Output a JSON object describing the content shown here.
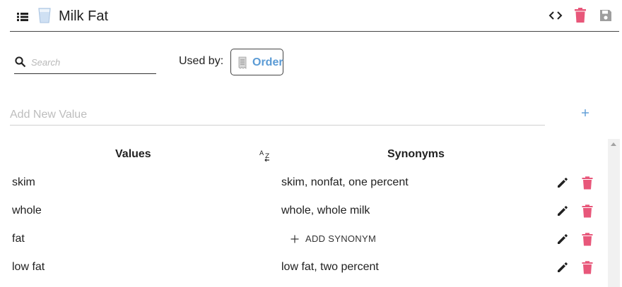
{
  "header": {
    "title": "Milk Fat",
    "icons": {
      "list": "list-icon",
      "entity": "milk-glass-icon",
      "code": "code-icon",
      "delete": "trash-icon",
      "save": "save-icon"
    }
  },
  "toolbar": {
    "search_placeholder": "Search",
    "used_by_label": "Used by:",
    "used_by_chip": "Order"
  },
  "add_value": {
    "placeholder": "Add New Value"
  },
  "table": {
    "headers": {
      "values": "Values",
      "synonyms": "Synonyms"
    },
    "add_synonym_label": "ADD SYNONYM",
    "rows": [
      {
        "value": "skim",
        "synonyms": "skim, nonfat, one percent"
      },
      {
        "value": "whole",
        "synonyms": "whole, whole milk"
      },
      {
        "value": "fat",
        "synonyms": ""
      },
      {
        "value": "low fat",
        "synonyms": "low fat, two percent"
      }
    ]
  },
  "colors": {
    "accent_blue": "#5b9bd5",
    "delete_pink": "#e8577a",
    "disabled_gray": "#9e9e9e",
    "text": "#212121"
  }
}
